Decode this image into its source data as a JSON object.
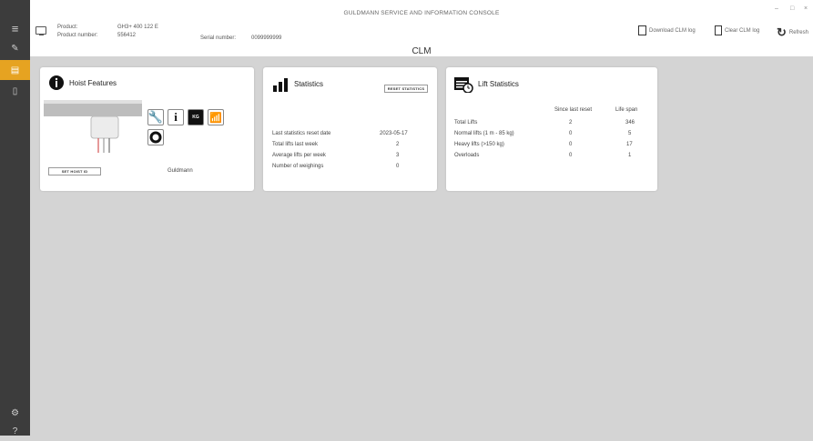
{
  "window": {
    "title": "GULDMANN SERVICE AND INFORMATION CONSOLE",
    "controls": {
      "minimize": "–",
      "maximize": "□",
      "close": "×"
    }
  },
  "sidebar": {
    "items": [
      {
        "icon": "menu-icon",
        "glyph": "≡"
      },
      {
        "icon": "pencil-icon",
        "glyph": "✎"
      },
      {
        "icon": "clm-icon",
        "glyph": "▤",
        "active": true
      },
      {
        "icon": "page-icon",
        "glyph": "▯"
      },
      {
        "icon": "settings-icon",
        "glyph": "⚙"
      },
      {
        "icon": "help-icon",
        "glyph": "?"
      }
    ]
  },
  "product": {
    "product_label": "Product:",
    "product_value": "GH3+ 400 122 E",
    "number_label": "Product number:",
    "number_value": "556412",
    "serial_label": "Serial number:",
    "serial_value": "0099999999"
  },
  "page_title": "CLM",
  "toolbar": {
    "download": "Download CLM log",
    "clear": "Clear CLM log",
    "refresh": "Refresh"
  },
  "hoist": {
    "title": "Hoist Features",
    "set_button": "SET HOIST ID",
    "manufacturer": "Guldmann",
    "features": [
      "wrench-icon",
      "info-icon",
      "weight-kg-icon",
      "wifi-icon",
      "ring-icon"
    ],
    "weight_glyph": "KG"
  },
  "statistics": {
    "title": "Statistics",
    "reset_button": "RESET STATISTICS",
    "rows": [
      {
        "label": "Last statistics reset date",
        "value": "2023-05-17"
      },
      {
        "label": "Total lifts last week",
        "value": "2"
      },
      {
        "label": "Average lifts per week",
        "value": "3"
      },
      {
        "label": "Number of weighings",
        "value": "0"
      }
    ]
  },
  "lift_statistics": {
    "title": "Lift Statistics",
    "col_since": "Since last reset",
    "col_life": "Life span",
    "rows": [
      {
        "label": "Total Lifts",
        "since": "2",
        "life": "346"
      },
      {
        "label": "Normal lifts (1 m - 85 kg)",
        "since": "0",
        "life": "5"
      },
      {
        "label": "Heavy lifts (>150 kg)",
        "since": "0",
        "life": "17"
      },
      {
        "label": "Overloads",
        "since": "0",
        "life": "1"
      }
    ]
  }
}
